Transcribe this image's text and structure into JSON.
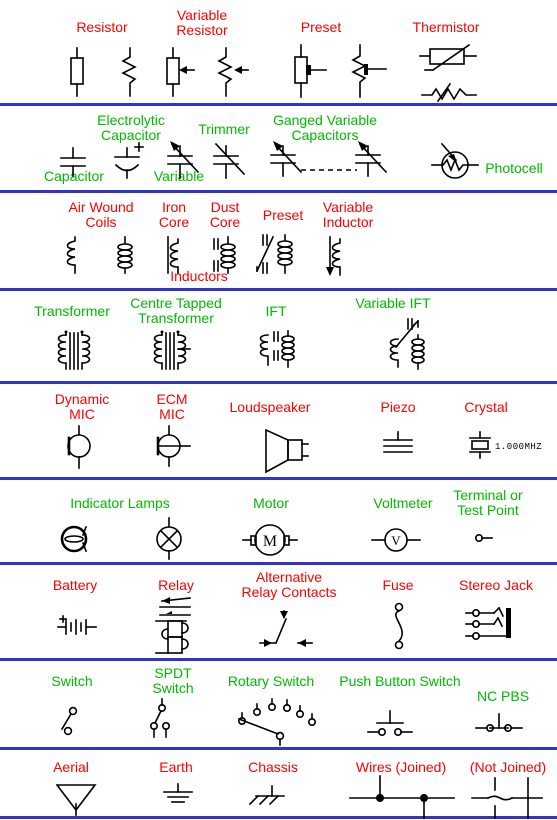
{
  "page": {
    "title": "Electronic Circuit Symbols Chart",
    "label_color_red": "#ff0000",
    "label_color_green": "#00bb00",
    "rule_color": "#3333cc",
    "symbol_color": "#000000",
    "background": "#ffffff"
  },
  "rows": [
    {
      "id": "resistors",
      "label_color": "red",
      "labels": [
        "Resistor",
        "Variable Resistor",
        "Preset",
        "Thermistor"
      ]
    },
    {
      "id": "capacitors",
      "label_color": "green",
      "labels": [
        "Capacitor",
        "Electrolytic Capacitor",
        "Variable",
        "Trimmer",
        "Ganged Variable Capacitors",
        "Photocell"
      ]
    },
    {
      "id": "inductors",
      "label_color": "red",
      "labels": [
        "Air Wound Coils",
        "Iron Core",
        "Dust Core",
        "Preset",
        "Variable Inductor",
        "Inductors"
      ]
    },
    {
      "id": "transformers",
      "label_color": "green",
      "labels": [
        "Transformer",
        "Centre Tapped Transformer",
        "IFT",
        "Variable IFT"
      ]
    },
    {
      "id": "audio",
      "label_color": "red",
      "labels": [
        "Dynamic MIC",
        "ECM MIC",
        "Loudspeaker",
        "Piezo",
        "Crystal"
      ],
      "crystal_value": "1.000MHZ"
    },
    {
      "id": "lamps-meters",
      "label_color": "green",
      "labels": [
        "Indicator Lamps",
        "Motor",
        "Voltmeter",
        "Terminal or Test Point"
      ],
      "motor_letter": "M",
      "voltmeter_letter": "V"
    },
    {
      "id": "power-relay",
      "label_color": "red",
      "labels": [
        "Battery",
        "Relay",
        "Alternative Relay Contacts",
        "Fuse",
        "Stereo Jack"
      ]
    },
    {
      "id": "switches",
      "label_color": "green",
      "labels": [
        "Switch",
        "SPDT Switch",
        "Rotary Switch",
        "Push Button Switch",
        "NC PBS"
      ]
    },
    {
      "id": "grounds-wires",
      "label_color": "red",
      "labels": [
        "Aerial",
        "Earth",
        "Chassis",
        "Wires (Joined)",
        "(Not Joined)"
      ]
    }
  ],
  "labels": {
    "resistor": "Resistor",
    "variable_resistor_l1": "Variable",
    "variable_resistor_l2": "Resistor",
    "preset_r": "Preset",
    "thermistor": "Thermistor",
    "capacitor": "Capacitor",
    "electrolytic_l1": "Electrolytic",
    "electrolytic_l2": "Capacitor",
    "variable_cap": "Variable",
    "trimmer": "Trimmer",
    "ganged_l1": "Ganged Variable",
    "ganged_l2": "Capacitors",
    "photocell": "Photocell",
    "air_wound_l1": "Air Wound",
    "air_wound_l2": "Coils",
    "iron_core_l1": "Iron",
    "iron_core_l2": "Core",
    "dust_core_l1": "Dust",
    "dust_core_l2": "Core",
    "preset_ind": "Preset",
    "variable_ind_l1": "Variable",
    "variable_ind_l2": "Inductor",
    "inductors": "Inductors",
    "transformer": "Transformer",
    "centre_tapped_l1": "Centre Tapped",
    "centre_tapped_l2": "Transformer",
    "ift": "IFT",
    "variable_ift": "Variable IFT",
    "dynamic_mic_l1": "Dynamic",
    "dynamic_mic_l2": "MIC",
    "ecm_mic_l1": "ECM",
    "ecm_mic_l2": "MIC",
    "loudspeaker": "Loudspeaker",
    "piezo": "Piezo",
    "crystal": "Crystal",
    "crystal_freq": "1.000MHZ",
    "indicator_lamps": "Indicator Lamps",
    "motor": "Motor",
    "motor_letter": "M",
    "voltmeter": "Voltmeter",
    "voltmeter_letter": "V",
    "terminal_l1": "Terminal or",
    "terminal_l2": "Test Point",
    "battery": "Battery",
    "relay": "Relay",
    "alt_relay_l1": "Alternative",
    "alt_relay_l2": "Relay Contacts",
    "fuse": "Fuse",
    "stereo_jack": "Stereo Jack",
    "switch": "Switch",
    "spdt_l1": "SPDT",
    "spdt_l2": "Switch",
    "rotary_switch": "Rotary Switch",
    "push_button_switch": "Push Button Switch",
    "nc_pbs": "NC PBS",
    "aerial": "Aerial",
    "earth": "Earth",
    "chassis": "Chassis",
    "wires_joined": "Wires (Joined)",
    "not_joined": "(Not Joined)"
  }
}
